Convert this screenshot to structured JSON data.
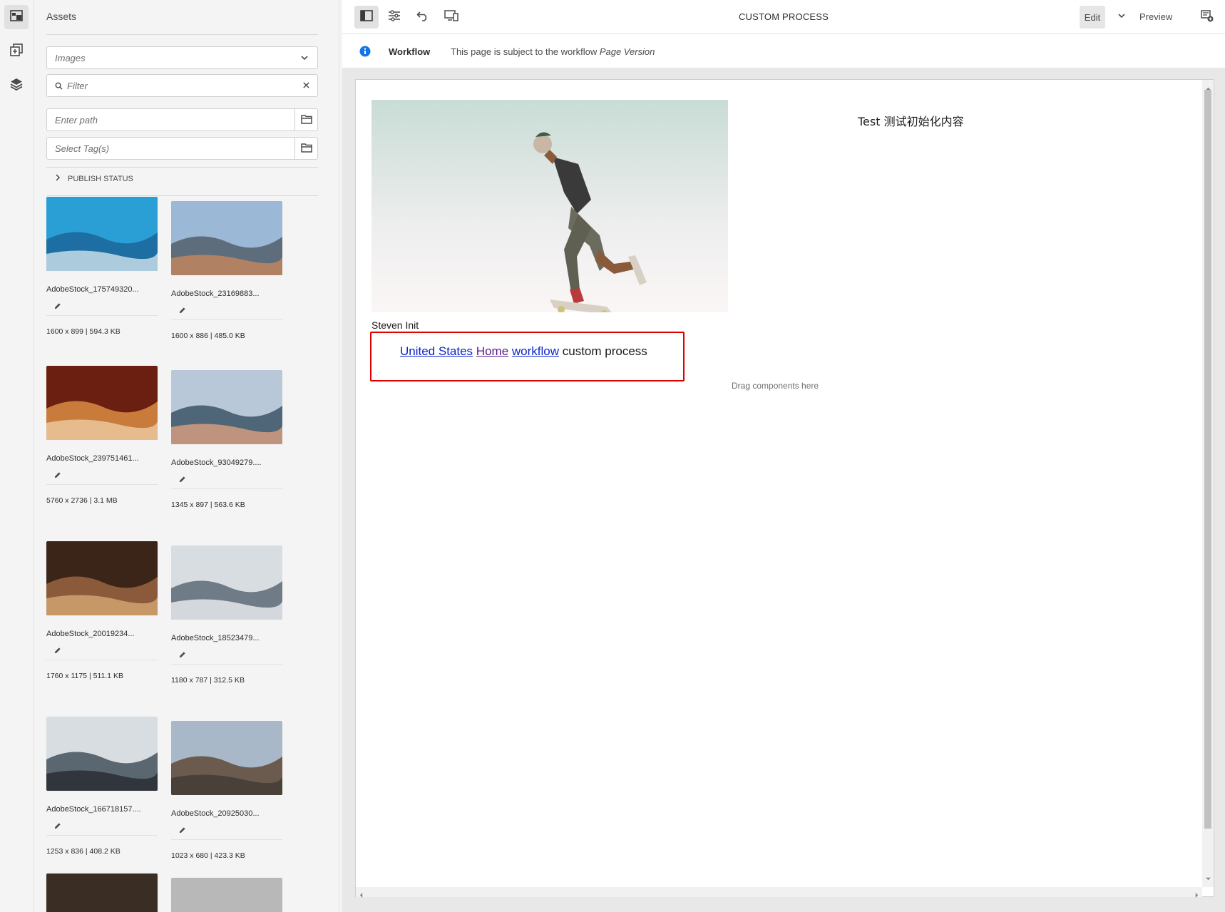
{
  "rail": {
    "items": [
      {
        "name": "assets"
      },
      {
        "name": "components"
      },
      {
        "name": "content-tree"
      }
    ]
  },
  "panel": {
    "title": "Assets",
    "asset_type": "Images",
    "filter_placeholder": "Filter",
    "path_placeholder": "Enter path",
    "tags_placeholder": "Select Tag(s)",
    "publish_status": "PUBLISH STATUS"
  },
  "assets": [
    {
      "name": "AdobeStock_175749320...",
      "meta": "1600 x 899 | 594.3 KB",
      "colors": [
        "#2a9fd6",
        "#1d6fa3",
        "#e9f3f7"
      ]
    },
    {
      "name": "AdobeStock_23169883...",
      "meta": "1600 x 886 | 485.0 KB",
      "colors": [
        "#9bb8d6",
        "#5d6d7c",
        "#d68a5a"
      ]
    },
    {
      "name": "AdobeStock_239751461...",
      "meta": "5760 x 2736 | 3.1 MB",
      "colors": [
        "#6b1f10",
        "#c97b3c",
        "#f2d8b0"
      ]
    },
    {
      "name": "AdobeStock_93049279....",
      "meta": "1345 x 897 | 563.6 KB",
      "colors": [
        "#b9c8d8",
        "#4f6679",
        "#f0a882"
      ]
    },
    {
      "name": "AdobeStock_20019234...",
      "meta": "1760 x 1175 | 511.1 KB",
      "colors": [
        "#3b2418",
        "#8a5a3a",
        "#e0b07a"
      ]
    },
    {
      "name": "AdobeStock_18523479...",
      "meta": "1180 x 787 | 312.5 KB",
      "colors": [
        "#d8dde2",
        "#6f7b86",
        "#ffffff"
      ]
    },
    {
      "name": "AdobeStock_166718157....",
      "meta": "1253 x 836 | 408.2 KB",
      "colors": [
        "#d7dde0",
        "#5b6770",
        "#1e2226"
      ]
    },
    {
      "name": "AdobeStock_20925030...",
      "meta": "1023 x 680 | 423.3 KB",
      "colors": [
        "#a8b8c8",
        "#6b5b4e",
        "#3a3430"
      ]
    }
  ],
  "toolbar": {
    "title": "CUSTOM PROCESS",
    "edit_label": "Edit",
    "preview_label": "Preview"
  },
  "workflow": {
    "label": "Workflow",
    "text": "This page is subject to the workflow ",
    "workflow_name": "Page Version"
  },
  "page": {
    "test_text": "Test 测试初始化内容",
    "author": "Steven Init",
    "breadcrumb": [
      {
        "label": "United States"
      },
      {
        "label": "Home"
      },
      {
        "label": "workflow"
      }
    ],
    "breadcrumb_current": "custom process",
    "drag_hint": "Drag components here"
  },
  "colors": {
    "accent": "#0b24c8",
    "highlight": "#e00000",
    "info": "#1473e6"
  }
}
